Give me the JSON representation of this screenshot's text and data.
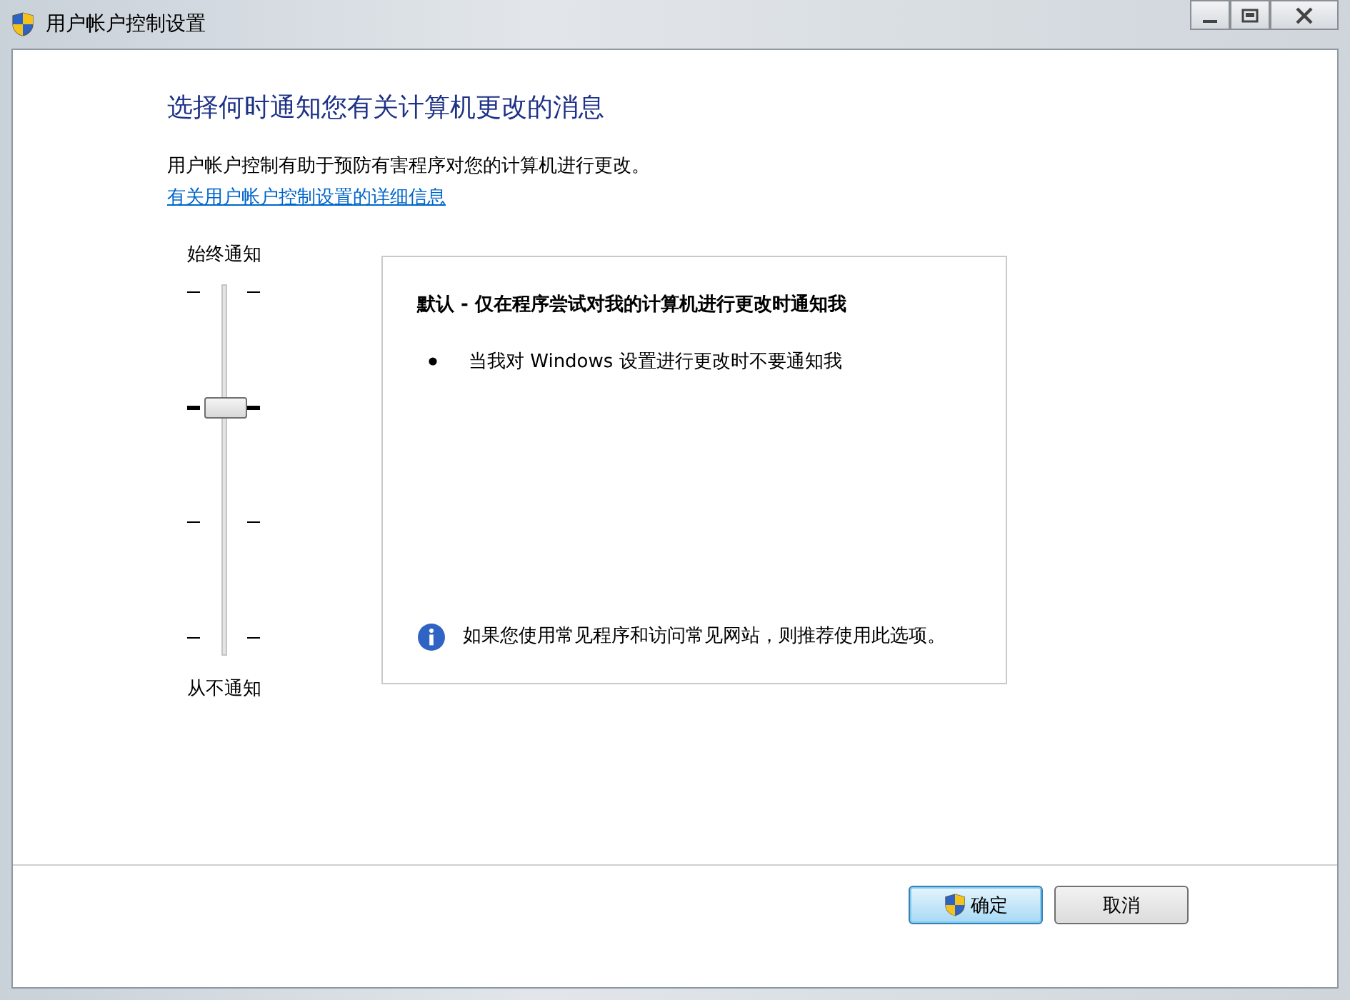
{
  "window": {
    "title": "用户帐户控制设置"
  },
  "heading": "选择何时通知您有关计算机更改的消息",
  "description": "用户帐户控制有助于预防有害程序对您的计算机进行更改。",
  "link": "有关用户帐户控制设置的详细信息",
  "slider": {
    "top_label": "始终通知",
    "bottom_label": "从不通知",
    "level": 0.6667
  },
  "info_panel": {
    "title": "默认 - 仅在程序尝试对我的计算机进行更改时通知我",
    "bullets": [
      "当我对 Windows 设置进行更改时不要通知我"
    ],
    "note": "如果您使用常见程序和访问常见网站，则推荐使用此选项。"
  },
  "buttons": [
    {
      "label": "确定",
      "kind": "primary"
    },
    {
      "label": "取消",
      "kind": "normal"
    }
  ]
}
